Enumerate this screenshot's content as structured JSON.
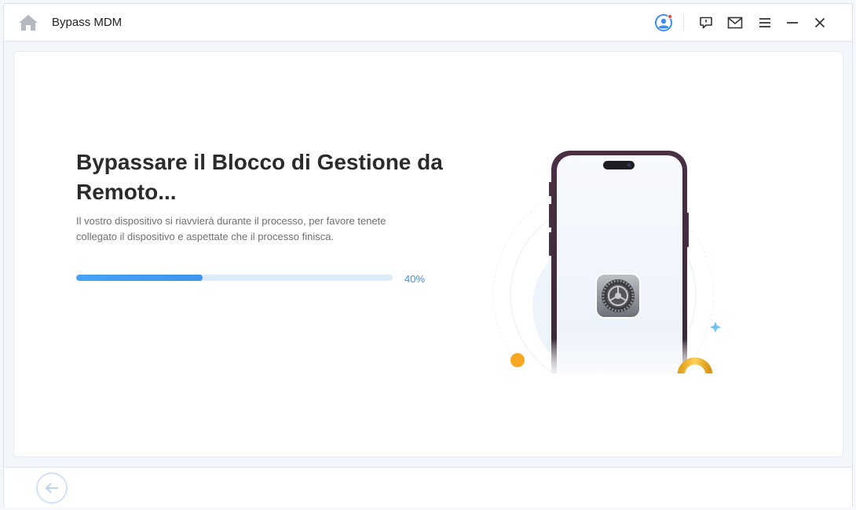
{
  "app": {
    "title": "Bypass MDM"
  },
  "titlebar_icons": {
    "home": "home-icon",
    "account": "user-account-icon",
    "feedback": "feedback-icon",
    "mail": "mail-icon",
    "menu": "menu-icon",
    "minimize": "minimize-icon",
    "close": "close-icon"
  },
  "main": {
    "heading": "Bypassare il Blocco di Gestione da Remoto...",
    "description": "Il vostro dispositivo si riavvierà durante il processo, per favore tenete collegato il dispositivo e aspettate che il processo finisca.",
    "progress": {
      "value": 0.4,
      "label": "40%"
    }
  },
  "footer": {
    "back_icon": "back-arrow-icon"
  },
  "colors": {
    "accent": "#3f8ef0",
    "progress_track": "#dcebf8",
    "notification_dot": "#ff3b30",
    "lock_gold": "#f4b728"
  }
}
